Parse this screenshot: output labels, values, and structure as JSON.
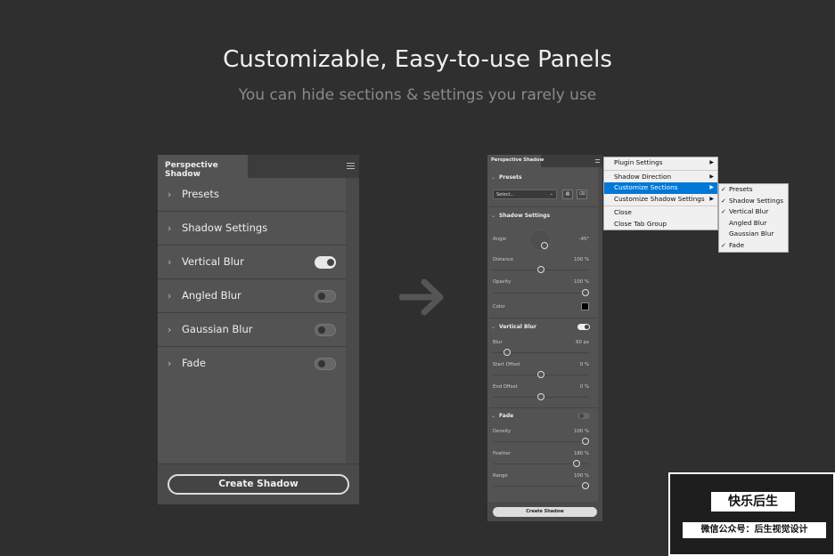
{
  "hero": {
    "title": "Customizable, Easy-to-use Panels",
    "subtitle": "You can hide sections & settings you rarely use"
  },
  "big_panel": {
    "tab": "Perspective Shadow",
    "sections": [
      {
        "label": "Presets",
        "toggle": null
      },
      {
        "label": "Shadow Settings",
        "toggle": null
      },
      {
        "label": "Vertical Blur",
        "toggle": "on"
      },
      {
        "label": "Angled Blur",
        "toggle": "off"
      },
      {
        "label": "Gaussian Blur",
        "toggle": "off"
      },
      {
        "label": "Fade",
        "toggle": "off"
      }
    ],
    "button": "Create Shadow"
  },
  "small_panel": {
    "tab": "Perspective Shadow",
    "presets": {
      "label": "Presets",
      "select_value": "Select..."
    },
    "shadow_settings": {
      "label": "Shadow Settings",
      "angle": {
        "label": "Angle",
        "value": "-45°"
      },
      "distance": {
        "label": "Distance",
        "value": "100 %"
      },
      "opacity": {
        "label": "Opacity",
        "value": "100 %"
      },
      "color": {
        "label": "Color",
        "swatch": "#000000"
      }
    },
    "vertical_blur": {
      "label": "Vertical Blur",
      "blur": {
        "label": "Blur",
        "value": "60 px"
      },
      "start_offset": {
        "label": "Start Offset",
        "value": "0 %"
      },
      "end_offset": {
        "label": "End Offset",
        "value": "0 %"
      }
    },
    "fade": {
      "label": "Fade",
      "density": {
        "label": "Density",
        "value": "100 %"
      },
      "feather": {
        "label": "Feather",
        "value": "180 %"
      },
      "range": {
        "label": "Range",
        "value": "100 %"
      }
    },
    "button": "Create Shadow"
  },
  "context_menu": {
    "items": [
      "Plugin Settings",
      "Shadow Direction",
      "Customize Sections",
      "Customize Shadow Settings",
      "Close",
      "Close Tab Group"
    ],
    "highlighted": "Customize Sections"
  },
  "submenu": {
    "items": [
      {
        "label": "Presets",
        "checked": true
      },
      {
        "label": "Shadow Settings",
        "checked": true
      },
      {
        "label": "Vertical Blur",
        "checked": true
      },
      {
        "label": "Angled Blur",
        "checked": false
      },
      {
        "label": "Gaussian Blur",
        "checked": false
      },
      {
        "label": "Fade",
        "checked": true
      }
    ]
  },
  "watermark": {
    "line1": "快乐后生",
    "line2": "微信公众号：后生视觉设计"
  },
  "colors": {
    "background": "#2f2f2f",
    "panel": "#535353",
    "highlight": "#0078d7"
  }
}
